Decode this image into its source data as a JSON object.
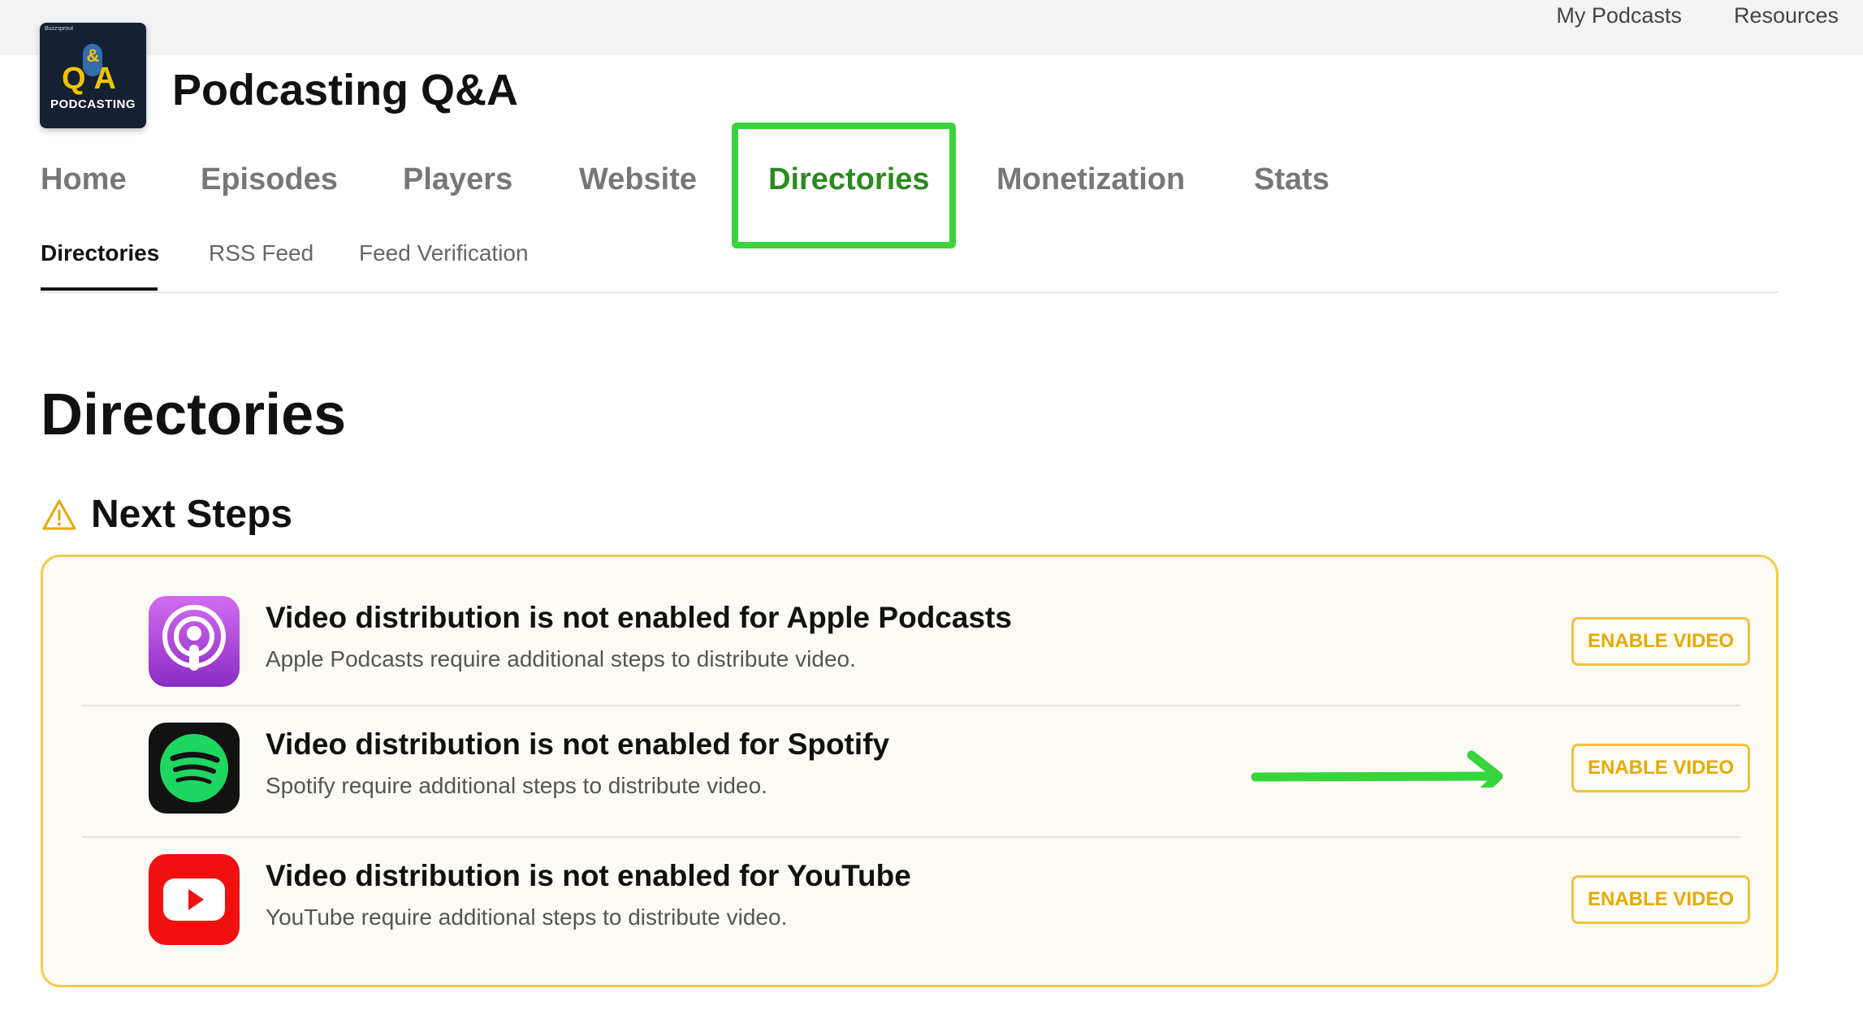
{
  "topnav": {
    "links": [
      "My Podcasts",
      "Resources"
    ]
  },
  "podcast": {
    "title": "Podcasting Q&A",
    "logo": {
      "tiny": "Buzzsprout",
      "amp": "&",
      "qa": "QA",
      "word": "PODCASTING"
    }
  },
  "mainnav": {
    "items": [
      "Home",
      "Episodes",
      "Players",
      "Website",
      "Directories",
      "Monetization",
      "Stats"
    ],
    "active": "Directories",
    "active_color": "#2b8a1e",
    "highlight_color": "#38d43c"
  },
  "subnav": {
    "items": [
      "Directories",
      "RSS Feed",
      "Feed Verification"
    ],
    "active": "Directories"
  },
  "page": {
    "title": "Directories"
  },
  "next_steps": {
    "label": "Next Steps",
    "icon": "warning-icon",
    "accent_color": "#f2cc4a",
    "rows": [
      {
        "icon": "apple-podcasts-icon",
        "title": "Video distribution is not enabled for Apple Podcasts",
        "desc": "Apple Podcasts require additional steps to distribute video.",
        "button": "ENABLE VIDEO"
      },
      {
        "icon": "spotify-icon",
        "title": "Video distribution is not enabled for Spotify",
        "desc": "Spotify require additional steps to distribute video.",
        "button": "ENABLE VIDEO"
      },
      {
        "icon": "youtube-icon",
        "title": "Video distribution is not enabled for YouTube",
        "desc": "YouTube require additional steps to distribute video.",
        "button": "ENABLE VIDEO"
      }
    ]
  },
  "annotation": {
    "arrow_color": "#38d43c"
  }
}
